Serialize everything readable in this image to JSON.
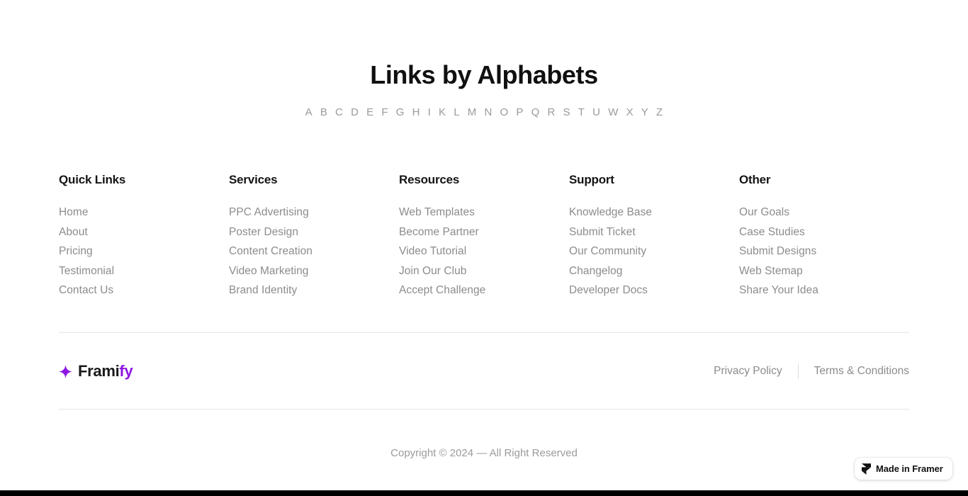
{
  "heading": "Links by Alphabets",
  "alphabet": {
    "letters": [
      "A",
      "B",
      "C",
      "D",
      "E",
      "F",
      "G",
      "H",
      "I",
      "K",
      "L",
      "M",
      "N",
      "O",
      "P",
      "Q",
      "R",
      "S",
      "T",
      "U",
      "W",
      "X",
      "Y",
      "Z"
    ]
  },
  "columns": [
    {
      "title": "Quick Links",
      "links": [
        "Home",
        "About",
        "Pricing",
        "Testimonial",
        "Contact Us"
      ]
    },
    {
      "title": "Services",
      "links": [
        "PPC Advertising",
        "Poster Design",
        "Content Creation",
        "Video Marketing",
        "Brand Identity"
      ]
    },
    {
      "title": "Resources",
      "links": [
        "Web Templates",
        "Become Partner",
        "Video Tutorial",
        "Join Our Club",
        "Accept Challenge"
      ]
    },
    {
      "title": "Support",
      "links": [
        "Knowledge Base",
        "Submit Ticket",
        "Our Community",
        "Changelog",
        "Developer Docs"
      ]
    },
    {
      "title": "Other",
      "links": [
        "Our Goals",
        "Case Studies",
        "Submit Designs",
        "Web Stemap",
        "Share Your Idea"
      ]
    }
  ],
  "brand": {
    "icon": "sparkle-star-icon",
    "name_primary": "Frami",
    "name_accent": "fy",
    "accent_color": "#8f16e3"
  },
  "legal": {
    "privacy": "Privacy Policy",
    "terms": "Terms & Conditions"
  },
  "copyright": "Copyright © 2024 — All Right Reserved",
  "framer_badge": {
    "icon": "framer-logo-icon",
    "label": "Made in Framer"
  }
}
